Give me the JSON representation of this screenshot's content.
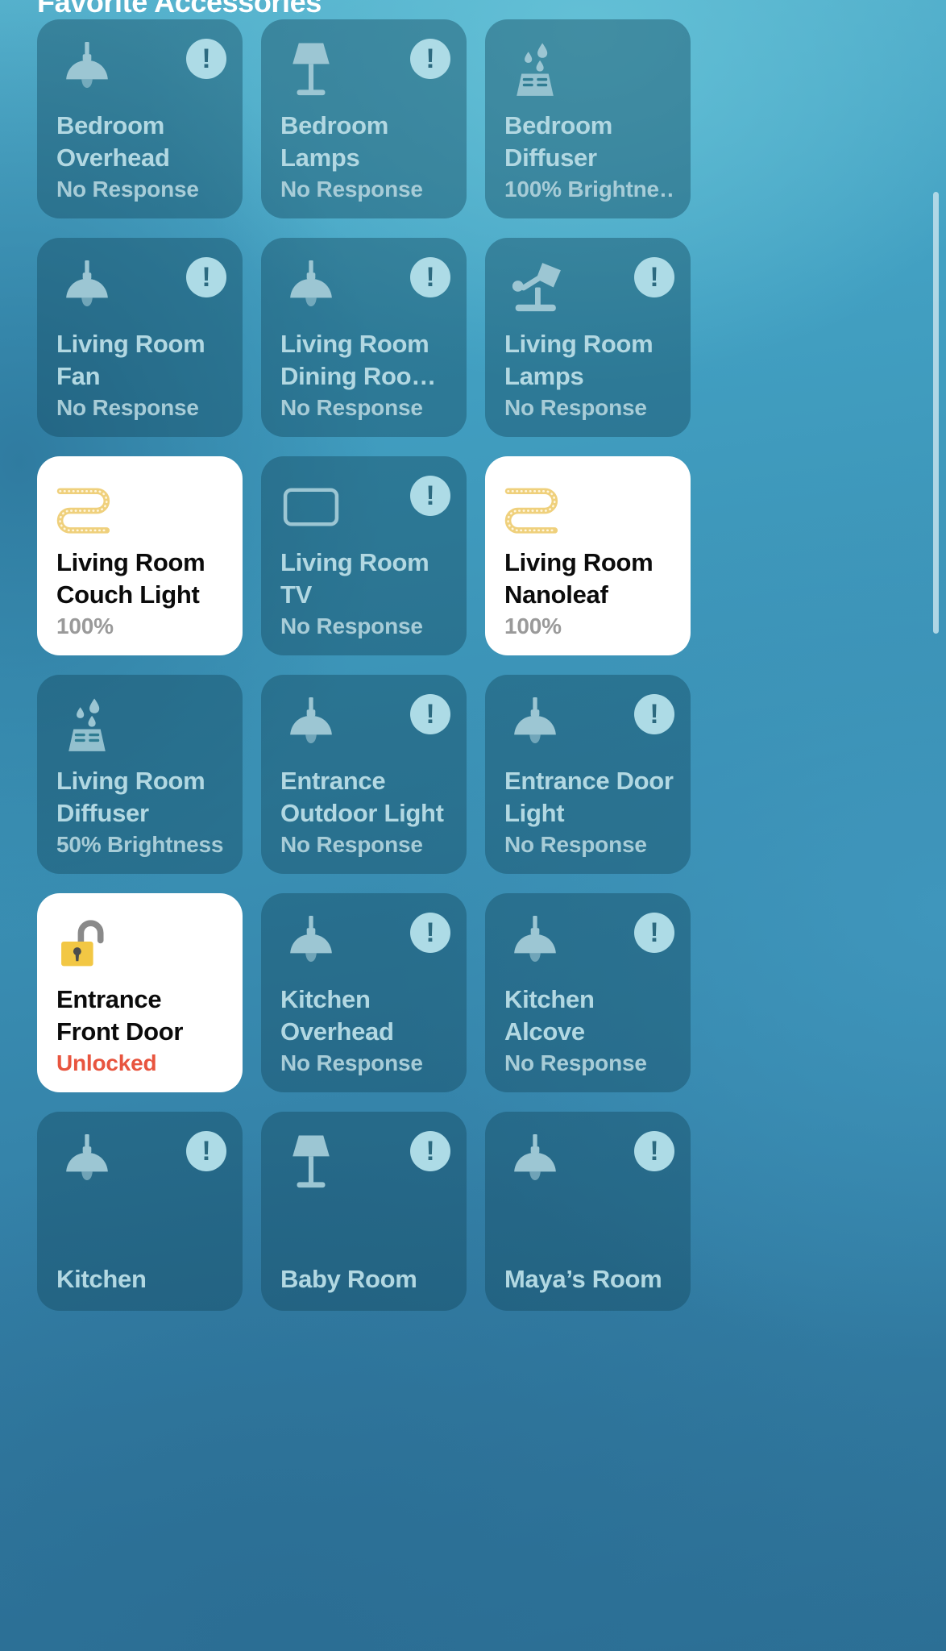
{
  "section": {
    "title": "Favorite Accessories"
  },
  "colors": {
    "alert_red": "#F2523A",
    "tile_inactive_bg": "rgba(20,72,92,0.42)",
    "tile_active_bg": "#FFFFFF",
    "inactive_title": "#B2D8E2",
    "badge_bg": "#ADDBE6",
    "lock_yellow": "#F2C744",
    "strip_yellow": "#F0D27E",
    "background_teal": "#3E93B8"
  },
  "icons": {
    "warning": "exclamation-badge-icon",
    "pendant": "pendant-light-icon",
    "floor_lamp": "floor-lamp-icon",
    "diffuser": "humidifier-diffuser-icon",
    "desk_lamp": "desk-lamp-icon",
    "light_strip": "light-strip-icon",
    "tv": "television-icon",
    "lock_open": "unlocked-padlock-icon"
  },
  "scrollbar": {
    "visible": true
  },
  "tiles": [
    {
      "name": "Bedroom Overhead",
      "status": "No Response",
      "state": "off",
      "alert": true,
      "warning": true,
      "icon": "pendant"
    },
    {
      "name": "Bedroom Lamps",
      "status": "No Response",
      "state": "off",
      "alert": true,
      "warning": true,
      "icon": "floor_lamp"
    },
    {
      "name": "Bedroom Diffuser",
      "status": "100% Brightne…",
      "state": "off",
      "alert": false,
      "warning": false,
      "icon": "diffuser"
    },
    {
      "name": "Living Room Fan",
      "status": "No Response",
      "state": "off",
      "alert": true,
      "warning": true,
      "icon": "pendant"
    },
    {
      "name": "Living Room Dining Roo…",
      "status": "No Response",
      "state": "off",
      "alert": true,
      "warning": true,
      "icon": "pendant"
    },
    {
      "name": "Living Room Lamps",
      "status": "No Response",
      "state": "off",
      "alert": true,
      "warning": true,
      "icon": "desk_lamp"
    },
    {
      "name": "Living Room Couch Light",
      "status": "100%",
      "state": "on",
      "alert": false,
      "warning": false,
      "icon": "light_strip"
    },
    {
      "name": "Living Room TV",
      "status": "No Response",
      "state": "off",
      "alert": true,
      "warning": true,
      "icon": "tv"
    },
    {
      "name": "Living Room Nanoleaf",
      "status": "100%",
      "state": "on",
      "alert": false,
      "warning": false,
      "icon": "light_strip"
    },
    {
      "name": "Living Room Diffuser",
      "status": "50% Brightness",
      "state": "off",
      "alert": false,
      "warning": false,
      "icon": "diffuser"
    },
    {
      "name": "Entrance Outdoor Light",
      "status": "No Response",
      "state": "off",
      "alert": true,
      "warning": true,
      "icon": "pendant"
    },
    {
      "name": "Entrance Door Light",
      "status": "No Response",
      "state": "off",
      "alert": true,
      "warning": true,
      "icon": "pendant"
    },
    {
      "name": "Entrance Front Door",
      "status": "Unlocked",
      "state": "on",
      "alert": true,
      "warning": false,
      "icon": "lock_open"
    },
    {
      "name": "Kitchen Overhead",
      "status": "No Response",
      "state": "off",
      "alert": true,
      "warning": true,
      "icon": "pendant"
    },
    {
      "name": "Kitchen Alcove",
      "status": "No Response",
      "state": "off",
      "alert": true,
      "warning": true,
      "icon": "pendant"
    },
    {
      "name": "Kitchen",
      "status": "",
      "state": "off",
      "alert": false,
      "warning": true,
      "icon": "pendant"
    },
    {
      "name": "Baby Room",
      "status": "",
      "state": "off",
      "alert": false,
      "warning": true,
      "icon": "floor_lamp"
    },
    {
      "name": "Maya’s Room",
      "status": "",
      "state": "off",
      "alert": false,
      "warning": true,
      "icon": "pendant"
    }
  ]
}
